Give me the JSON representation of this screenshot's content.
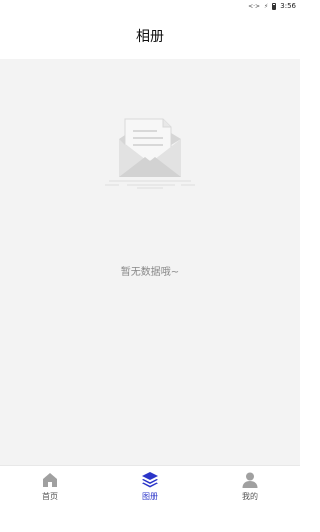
{
  "status_bar": {
    "time": "3:56",
    "icons": [
      "code-icon",
      "wifi-icon",
      "battery-icon"
    ]
  },
  "header": {
    "title": "相册"
  },
  "empty_state": {
    "icon": "empty-mail-icon",
    "message": "暂无数据哦~"
  },
  "tab_bar": {
    "tabs": [
      {
        "label": "首页",
        "icon": "home-icon",
        "active": false
      },
      {
        "label": "图册",
        "icon": "layers-icon",
        "active": true
      },
      {
        "label": "我的",
        "icon": "user-icon",
        "active": false
      }
    ],
    "colors": {
      "active": "#2b35c9",
      "inactive": "#9a9a9a"
    }
  }
}
